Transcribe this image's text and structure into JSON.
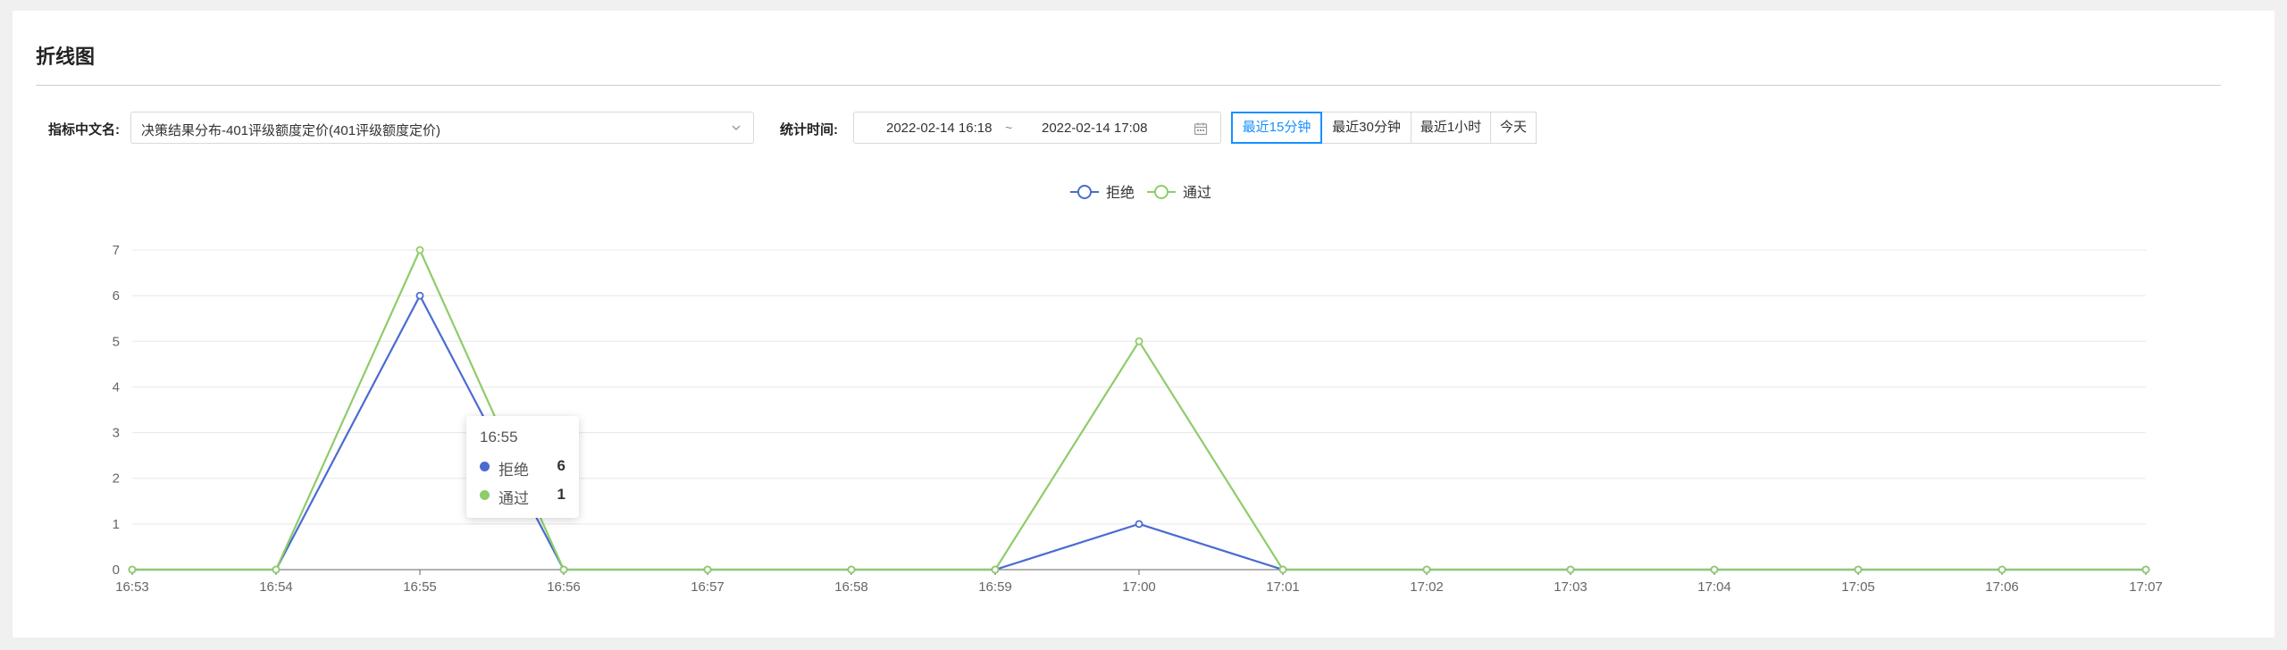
{
  "page": {
    "title": "折线图"
  },
  "filters": {
    "metric_label": "指标中文名:",
    "metric_value": "决策结果分布-401评级额度定价(401评级额度定价)",
    "time_label": "统计时间:",
    "start": "2022-02-14 16:18",
    "separator": "~",
    "end": "2022-02-14 17:08",
    "quick_ranges": [
      {
        "label": "最近15分钟",
        "active": true
      },
      {
        "label": "最近30分钟",
        "active": false
      },
      {
        "label": "最近1小时",
        "active": false
      },
      {
        "label": "今天",
        "active": false
      }
    ]
  },
  "chart_data": {
    "type": "line",
    "title": "",
    "xlabel": "",
    "ylabel": "",
    "categories": [
      "16:53",
      "16:54",
      "16:55",
      "16:56",
      "16:57",
      "16:58",
      "16:59",
      "17:00",
      "17:01",
      "17:02",
      "17:03",
      "17:04",
      "17:05",
      "17:06",
      "17:07"
    ],
    "series": [
      {
        "name": "拒绝",
        "color": "#4a6bd2",
        "values": [
          0,
          0,
          6,
          0,
          0,
          0,
          0,
          1,
          0,
          0,
          0,
          0,
          0,
          0,
          0
        ]
      },
      {
        "name": "通过",
        "color": "#8fcc6a",
        "values": [
          0,
          0,
          7,
          0,
          0,
          0,
          0,
          5,
          0,
          0,
          0,
          0,
          0,
          0,
          0
        ]
      }
    ],
    "ylim": [
      0,
      7
    ],
    "yticks": [
      0,
      1,
      2,
      3,
      4,
      5,
      6,
      7
    ],
    "grid": true,
    "legend_position": "top-center",
    "tooltip": {
      "title": "16:55",
      "rows": [
        {
          "name": "拒绝",
          "value": "6",
          "color": "#4a6bd2"
        },
        {
          "name": "通过",
          "value": "1",
          "color": "#8fcc6a"
        }
      ]
    }
  }
}
